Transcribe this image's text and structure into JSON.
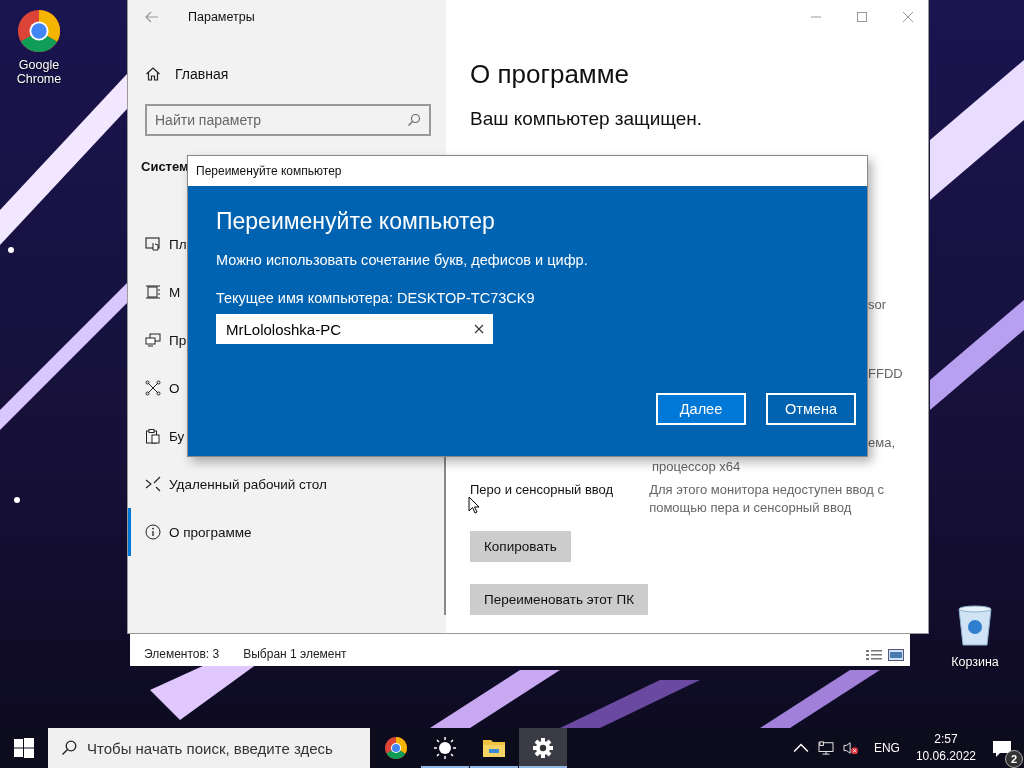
{
  "desktop_icons": [
    {
      "kind": "chrome",
      "label": "Google Chrome"
    },
    {
      "kind": "recycle-bin",
      "label": "Корзина"
    }
  ],
  "explorer_status": [
    "Элементов: 3",
    "Выбран 1 элемент"
  ],
  "settings": {
    "title": "Параметры",
    "home": "Главная",
    "search": {
      "placeholder": "Найти параметр"
    },
    "section": "Систем",
    "nav": [
      {
        "label": "Пл",
        "selected": false
      },
      {
        "label": "М",
        "selected": false
      },
      {
        "label": "Пр",
        "selected": false
      },
      {
        "label": "О",
        "selected": false
      },
      {
        "label": "Бу",
        "selected": false
      },
      {
        "label": "Удаленный рабочий стол",
        "selected": false
      },
      {
        "label": "О программе",
        "selected": true
      }
    ],
    "heading": "О программе",
    "status": "Ваш компьютер защищен.",
    "fragments": [
      "sor",
      "FFDD",
      "ема,",
      "процессор x64"
    ],
    "pen": {
      "label": "Перо и сенсорный ввод",
      "value": "Для этого монитора недоступен ввод с помощью пера и сенсорный ввод"
    },
    "buttons": [
      "Копировать",
      "Переименовать этот ПК"
    ]
  },
  "dialog": {
    "title": "Переименуйте компьютер",
    "heading": "Переименуйте компьютер",
    "hint": "Можно использовать сочетание букв, дефисов и цифр.",
    "current": "Текущее имя компьютера: DESKTOP-TC73CK9",
    "value": "MrLololoshka-PC",
    "buttons": [
      {
        "label": "Далее",
        "primary": true
      },
      {
        "label": "Отмена",
        "primary": false
      }
    ]
  },
  "taskbar": {
    "search": {
      "placeholder": "Чтобы начать поиск, введите здесь"
    },
    "apps": [
      {
        "kind": "chrome",
        "running": false,
        "selected": false
      },
      {
        "kind": "brightness",
        "running": true,
        "selected": false
      },
      {
        "kind": "folder",
        "running": true,
        "selected": false
      },
      {
        "kind": "settings",
        "running": true,
        "selected": true
      }
    ],
    "language": "ENG",
    "time": "2:57",
    "date": "10.06.2022",
    "notifications": "2"
  }
}
